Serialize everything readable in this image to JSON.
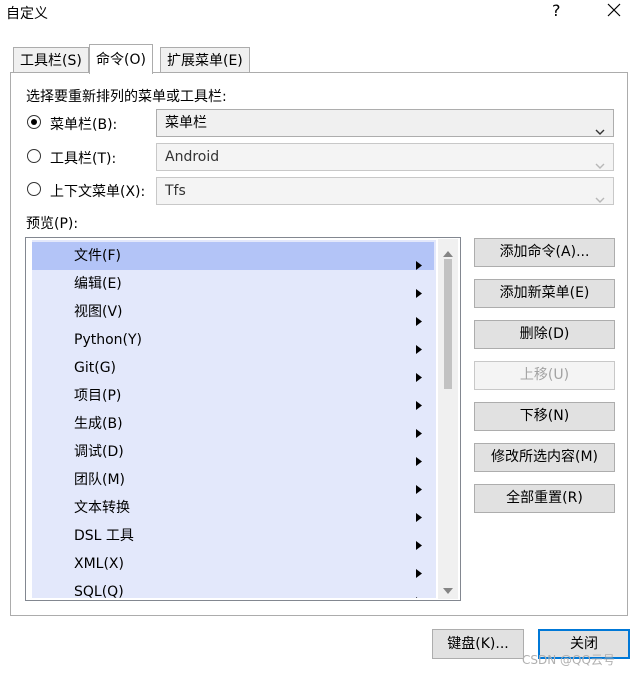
{
  "window": {
    "title": "自定义",
    "help_glyph": "?"
  },
  "tabs": [
    {
      "label": "工具栏(S)",
      "active": false
    },
    {
      "label": "命令(O)",
      "active": true
    },
    {
      "label": "扩展菜单(E)",
      "active": false
    }
  ],
  "choose_label": "选择要重新排列的菜单或工具栏:",
  "options": [
    {
      "label": "菜单栏(B):",
      "checked": true,
      "combo_value": "菜单栏",
      "enabled": true
    },
    {
      "label": "工具栏(T):",
      "checked": false,
      "combo_value": "Android",
      "enabled": false
    },
    {
      "label": "上下文菜单(X):",
      "checked": false,
      "combo_value": "Tfs",
      "enabled": false
    }
  ],
  "preview_label": "预览(P):",
  "menu_items": [
    {
      "label": "文件(F)",
      "selected": true
    },
    {
      "label": "编辑(E)",
      "selected": false
    },
    {
      "label": "视图(V)",
      "selected": false
    },
    {
      "label": "Python(Y)",
      "selected": false
    },
    {
      "label": "Git(G)",
      "selected": false
    },
    {
      "label": "项目(P)",
      "selected": false
    },
    {
      "label": "生成(B)",
      "selected": false
    },
    {
      "label": "调试(D)",
      "selected": false
    },
    {
      "label": "团队(M)",
      "selected": false
    },
    {
      "label": "文本转换",
      "selected": false
    },
    {
      "label": "DSL 工具",
      "selected": false
    },
    {
      "label": "XML(X)",
      "selected": false
    },
    {
      "label": "SQL(Q)",
      "selected": false
    }
  ],
  "side_buttons": [
    {
      "label": "添加命令(A)...",
      "enabled": true
    },
    {
      "label": "添加新菜单(E)",
      "enabled": true
    },
    {
      "label": "删除(D)",
      "enabled": true
    },
    {
      "label": "上移(U)",
      "enabled": false
    },
    {
      "label": "下移(N)",
      "enabled": true
    },
    {
      "label": "修改所选内容(M)",
      "enabled": true
    },
    {
      "label": "全部重置(R)",
      "enabled": true
    }
  ],
  "bottom_buttons": {
    "keyboard": "键盘(K)...",
    "close": "关闭"
  },
  "watermark": "CSDN @QQ云号",
  "colors": {
    "menu_background": "#e3e8fb",
    "menu_selected": "#b3c4f7",
    "default_button_border": "#0078d7"
  }
}
